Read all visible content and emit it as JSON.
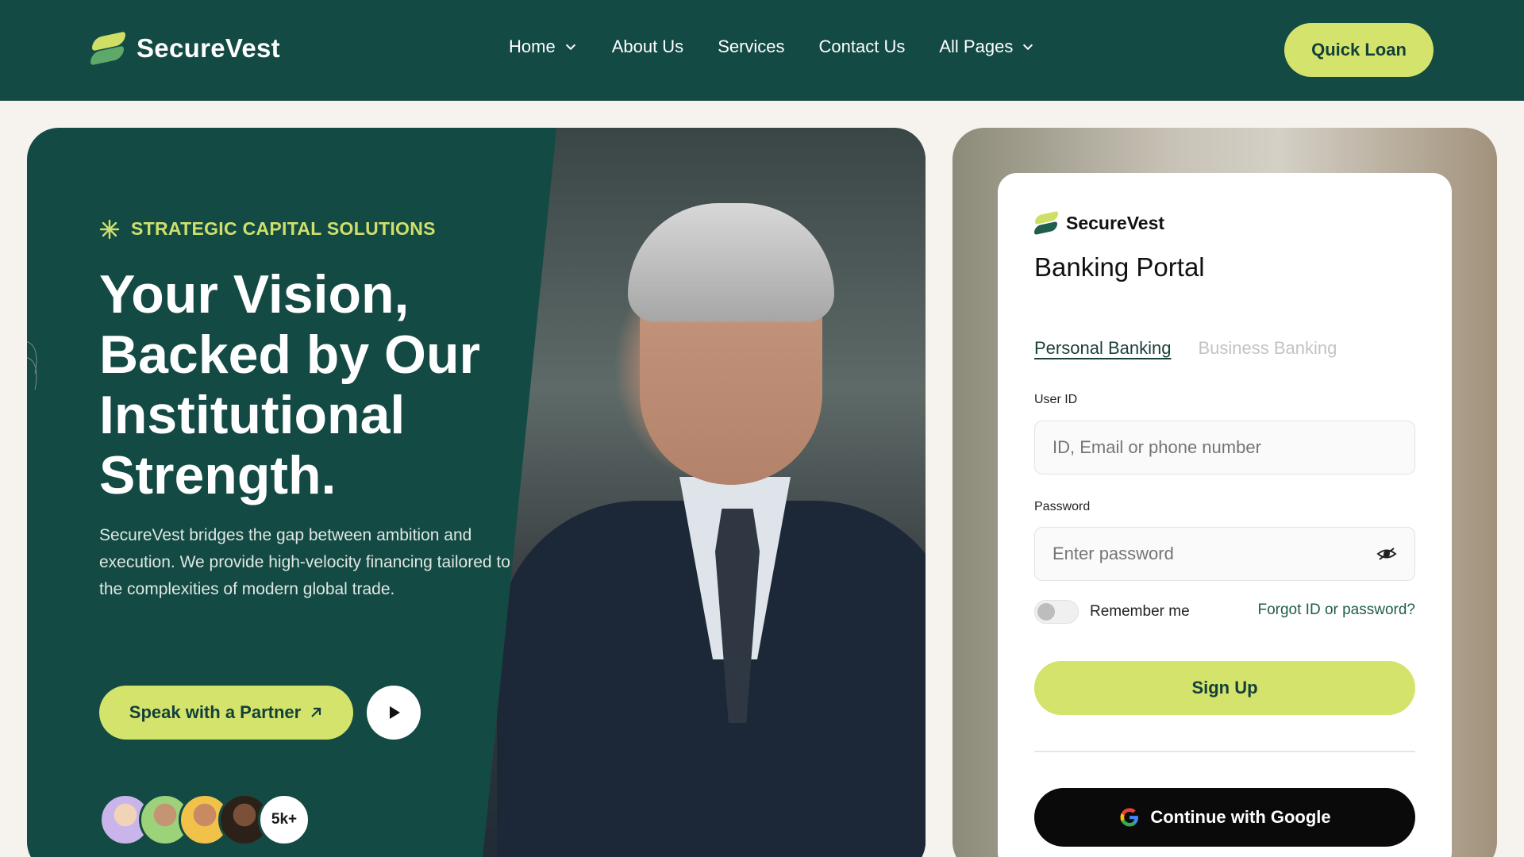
{
  "nav": {
    "brand": "SecureVest",
    "items": [
      {
        "label": "Home",
        "has_dropdown": true
      },
      {
        "label": "About Us",
        "has_dropdown": false
      },
      {
        "label": "Services",
        "has_dropdown": false
      },
      {
        "label": "Contact Us",
        "has_dropdown": false
      },
      {
        "label": "All Pages",
        "has_dropdown": true
      }
    ],
    "cta": "Quick Loan"
  },
  "hero": {
    "eyebrow": "STRATEGIC CAPITAL SOLUTIONS",
    "headline": "Your Vision, Backed by Our Institutional Strength.",
    "lead": "SecureVest bridges the gap between ambition and execution. We provide high-velocity financing tailored to the complexities of modern global trade.",
    "cta": "Speak with a Partner",
    "community_count": "5k+"
  },
  "login": {
    "brand": "SecureVest",
    "title": "Banking Portal",
    "tabs": [
      {
        "label": "Personal Banking",
        "active": true
      },
      {
        "label": "Business Banking",
        "active": false
      }
    ],
    "user_label": "User ID",
    "user_placeholder": "ID, Email or phone number",
    "password_label": "Password",
    "password_placeholder": "Enter password",
    "remember": "Remember me",
    "forgot": "Forgot ID or password?",
    "submit": "Sign Up",
    "google": "Continue with Google"
  },
  "colors": {
    "brand_dark": "#134a44",
    "accent": "#d3e36b"
  }
}
